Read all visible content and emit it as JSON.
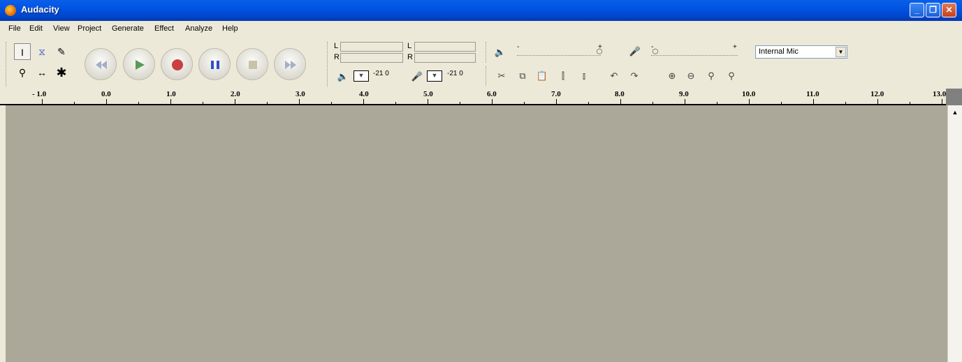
{
  "window": {
    "title": "Audacity",
    "minimize": "_",
    "maximize": "❐",
    "close": "✕"
  },
  "menu": [
    "File",
    "Edit",
    "View",
    "Project",
    "Generate",
    "Effect",
    "Analyze",
    "Help"
  ],
  "meters": {
    "playback_L": "L",
    "playback_R": "R",
    "record_L": "L",
    "record_R": "R",
    "playback_scale": "-21   0",
    "record_scale": "-21   0"
  },
  "mixer": {
    "output_minus": "-",
    "output_plus": "+",
    "input_minus": "-",
    "input_plus": "+"
  },
  "input_source": {
    "selected": "Internal Mic"
  },
  "ruler": {
    "labels": [
      "- 1.0",
      "0.0",
      "1.0",
      "2.0",
      "3.0",
      "4.0",
      "5.0",
      "6.0",
      "7.0",
      "8.0",
      "9.0",
      "10.0",
      "11.0",
      "12.0",
      "13.0"
    ]
  },
  "icons": {
    "tools": [
      "selection-tool-icon",
      "envelope-tool-icon",
      "draw-tool-icon",
      "zoom-tool-icon",
      "timeshift-tool-icon",
      "multi-tool-icon"
    ],
    "transport": [
      "skip-start-icon",
      "play-icon",
      "record-icon",
      "pause-icon",
      "stop-icon",
      "skip-end-icon"
    ]
  }
}
